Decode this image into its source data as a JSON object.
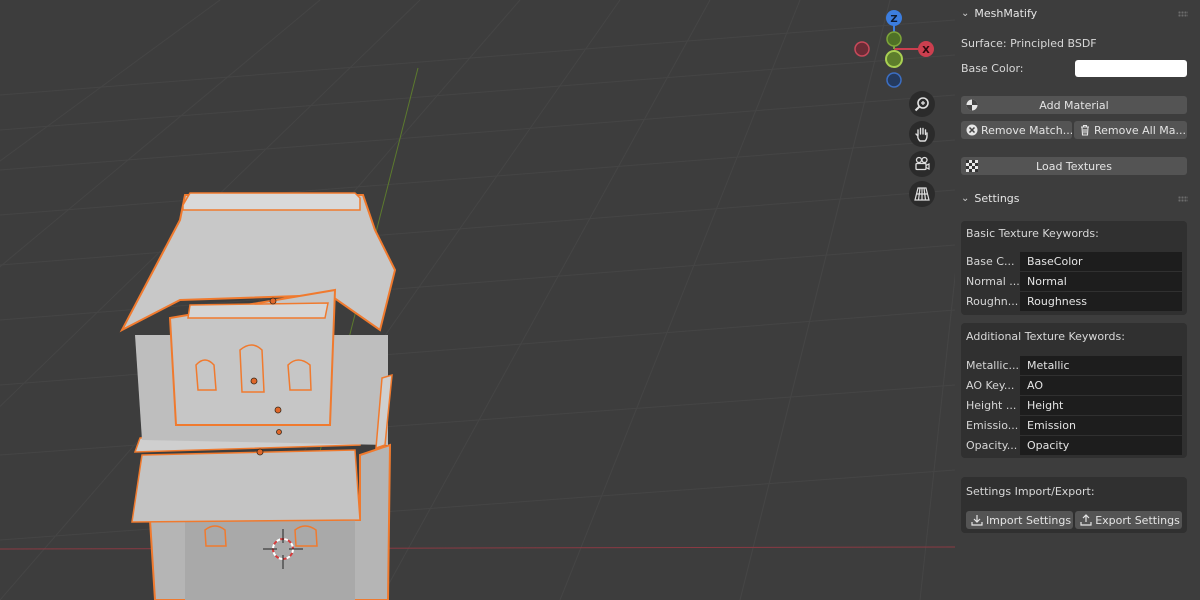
{
  "gizmo": {
    "z_label": "Z",
    "x_label": "X"
  },
  "viewport_tools": [
    "zoom-icon",
    "pan-hand-icon",
    "camera-icon",
    "perspective-grid-icon"
  ],
  "panel": {
    "addon_title": "MeshMatify",
    "surface_text": "Surface: Principled BSDF",
    "base_color_label": "Base Color:",
    "base_color_value": "#ffffff",
    "buttons": {
      "add_material": "Add Material",
      "remove_matching": "Remove Match...",
      "remove_all": "Remove All Ma...",
      "load_textures": "Load Textures"
    },
    "settings_title": "Settings",
    "basic_title": "Basic Texture Keywords:",
    "basic_keywords": [
      {
        "label": "Base C...",
        "value": "BaseColor"
      },
      {
        "label": "Normal ...",
        "value": "Normal"
      },
      {
        "label": "Roughn...",
        "value": "Roughness"
      }
    ],
    "additional_title": "Additional Texture Keywords:",
    "additional_keywords": [
      {
        "label": "Metallic...",
        "value": "Metallic"
      },
      {
        "label": "AO Key...",
        "value": "AO"
      },
      {
        "label": "Height ...",
        "value": "Height"
      },
      {
        "label": "Emissio...",
        "value": "Emission"
      },
      {
        "label": "Opacity...",
        "value": "Opacity"
      }
    ],
    "import_export_title": "Settings Import/Export:",
    "import_label": "Import Settings",
    "export_label": "Export Settings"
  },
  "colors": {
    "viewport_bg": "#3d3d3d",
    "selection_outline": "#f07a2e",
    "axis_x": "#cc3f4f",
    "axis_y": "#7ea63a",
    "axis_z": "#3c7ee0"
  }
}
